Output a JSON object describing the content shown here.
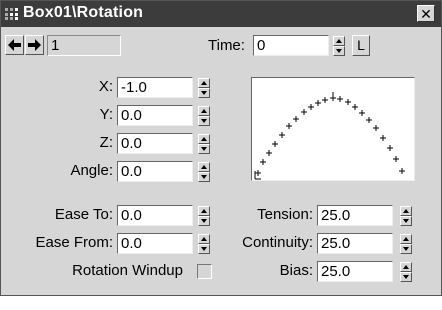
{
  "window": {
    "title": "Box01\\Rotation",
    "close_glyph": "✕"
  },
  "nav": {
    "prev_glyph": "🡐",
    "next_glyph": "🡒",
    "key_number": "1"
  },
  "time": {
    "label": "Time:",
    "value": "0",
    "lock_label": "L"
  },
  "params": [
    {
      "label": "X:",
      "value": "-1.0"
    },
    {
      "label": "Y:",
      "value": "0.0"
    },
    {
      "label": "Z:",
      "value": "0.0"
    },
    {
      "label": "Angle:",
      "value": "0.0"
    }
  ],
  "ease": [
    {
      "label": "Ease To:",
      "value": "0.0"
    },
    {
      "label": "Ease From:",
      "value": "0.0"
    }
  ],
  "tcb": [
    {
      "label": "Tension:",
      "value": "25.0"
    },
    {
      "label": "Continuity:",
      "value": "25.0"
    },
    {
      "label": "Bias:",
      "value": "25.0"
    }
  ],
  "windup": {
    "label": "Rotation Windup",
    "checked": false
  },
  "colors": {
    "titlebar": "#3c3c3c",
    "panel": "#d6d6d6"
  },
  "icons": [
    "window-menu-icon",
    "close-icon",
    "arrow-left-icon",
    "arrow-right-icon",
    "spinner-up-icon",
    "spinner-down-icon"
  ]
}
